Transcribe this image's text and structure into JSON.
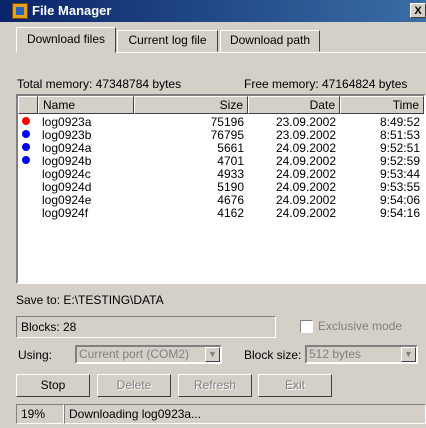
{
  "window": {
    "title": "File Manager",
    "close_label": "X"
  },
  "tabs": [
    {
      "label": "Download files",
      "active": true
    },
    {
      "label": "Current log file",
      "active": false
    },
    {
      "label": "Download path",
      "active": false
    }
  ],
  "memory": {
    "total_label": "Total memory: 47348784 bytes",
    "free_label": "Free memory: 47164824 bytes"
  },
  "files": {
    "columns": [
      "Name",
      "Size",
      "Date",
      "Time"
    ],
    "rows": [
      {
        "marker": "red",
        "name": "log0923a",
        "size": "75196",
        "date": "23.09.2002",
        "time": "8:49:52"
      },
      {
        "marker": "blue",
        "name": "log0923b",
        "size": "76795",
        "date": "23.09.2002",
        "time": "8:51:53"
      },
      {
        "marker": "blue",
        "name": "log0924a",
        "size": "5661",
        "date": "24.09.2002",
        "time": "9:52:51"
      },
      {
        "marker": "blue",
        "name": "log0924b",
        "size": "4701",
        "date": "24.09.2002",
        "time": "9:52:59"
      },
      {
        "marker": "",
        "name": "log0924c",
        "size": "4933",
        "date": "24.09.2002",
        "time": "9:53:44"
      },
      {
        "marker": "",
        "name": "log0924d",
        "size": "5190",
        "date": "24.09.2002",
        "time": "9:53:55"
      },
      {
        "marker": "",
        "name": "log0924e",
        "size": "4676",
        "date": "24.09.2002",
        "time": "9:54:06"
      },
      {
        "marker": "",
        "name": "log0924f",
        "size": "4162",
        "date": "24.09.2002",
        "time": "9:54:16"
      }
    ]
  },
  "save_to": "Save to: E:\\TESTING\\DATA",
  "blocks": "Blocks: 28",
  "exclusive_mode": {
    "label": "Exclusive mode",
    "checked": false
  },
  "using": {
    "label": "Using:",
    "value": "Current port (COM2)"
  },
  "block_size": {
    "label": "Block size:",
    "value": "512 bytes"
  },
  "buttons": {
    "stop": "Stop",
    "delete": "Delete",
    "refresh": "Refresh",
    "exit": "Exit"
  },
  "status": {
    "progress": "19%",
    "message": "Downloading log0923a..."
  },
  "colors": {
    "red_marker": "#ff0000",
    "blue_marker": "#0000ff",
    "titlebar": "#0a246a"
  }
}
